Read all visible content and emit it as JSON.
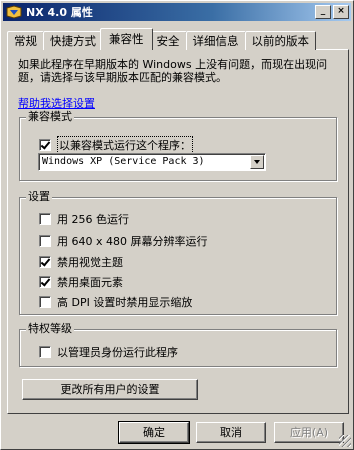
{
  "window": {
    "title": "NX 4.0 属性",
    "minimize": "_",
    "close": "×"
  },
  "tabs": [
    {
      "label": "常规",
      "active": false
    },
    {
      "label": "快捷方式",
      "active": false
    },
    {
      "label": "兼容性",
      "active": true
    },
    {
      "label": "安全",
      "active": false
    },
    {
      "label": "详细信息",
      "active": false
    },
    {
      "label": "以前的版本",
      "active": false
    }
  ],
  "intro": "如果此程序在早期版本的 Windows 上没有问题，而现在出现问题，请选择与该早期版本匹配的兼容模式。",
  "help_link": "帮助我选择设置",
  "compat_mode": {
    "group_title": "兼容模式",
    "checkbox_label": "以兼容模式运行这个程序：",
    "checked": true,
    "selected_os": "Windows XP (Service Pack 3)"
  },
  "settings": {
    "group_title": "设置",
    "items": [
      {
        "label": "用 256 色运行",
        "checked": false
      },
      {
        "label": "用 640 x 480 屏幕分辨率运行",
        "checked": false
      },
      {
        "label": "禁用视觉主题",
        "checked": true
      },
      {
        "label": "禁用桌面元素",
        "checked": true
      },
      {
        "label": "高 DPI 设置时禁用显示缩放",
        "checked": false
      }
    ]
  },
  "privilege": {
    "group_title": "特权等级",
    "checkbox_label": "以管理员身份运行此程序",
    "checked": false
  },
  "buttons": {
    "change_all_users": "更改所有用户的设置",
    "ok": "确定",
    "cancel": "取消",
    "apply": "应用(A)"
  },
  "colors": {
    "titlebar_start": "#0a246a",
    "titlebar_end": "#a6caf0",
    "link": "#0000ff",
    "face": "#d4d0c8"
  }
}
